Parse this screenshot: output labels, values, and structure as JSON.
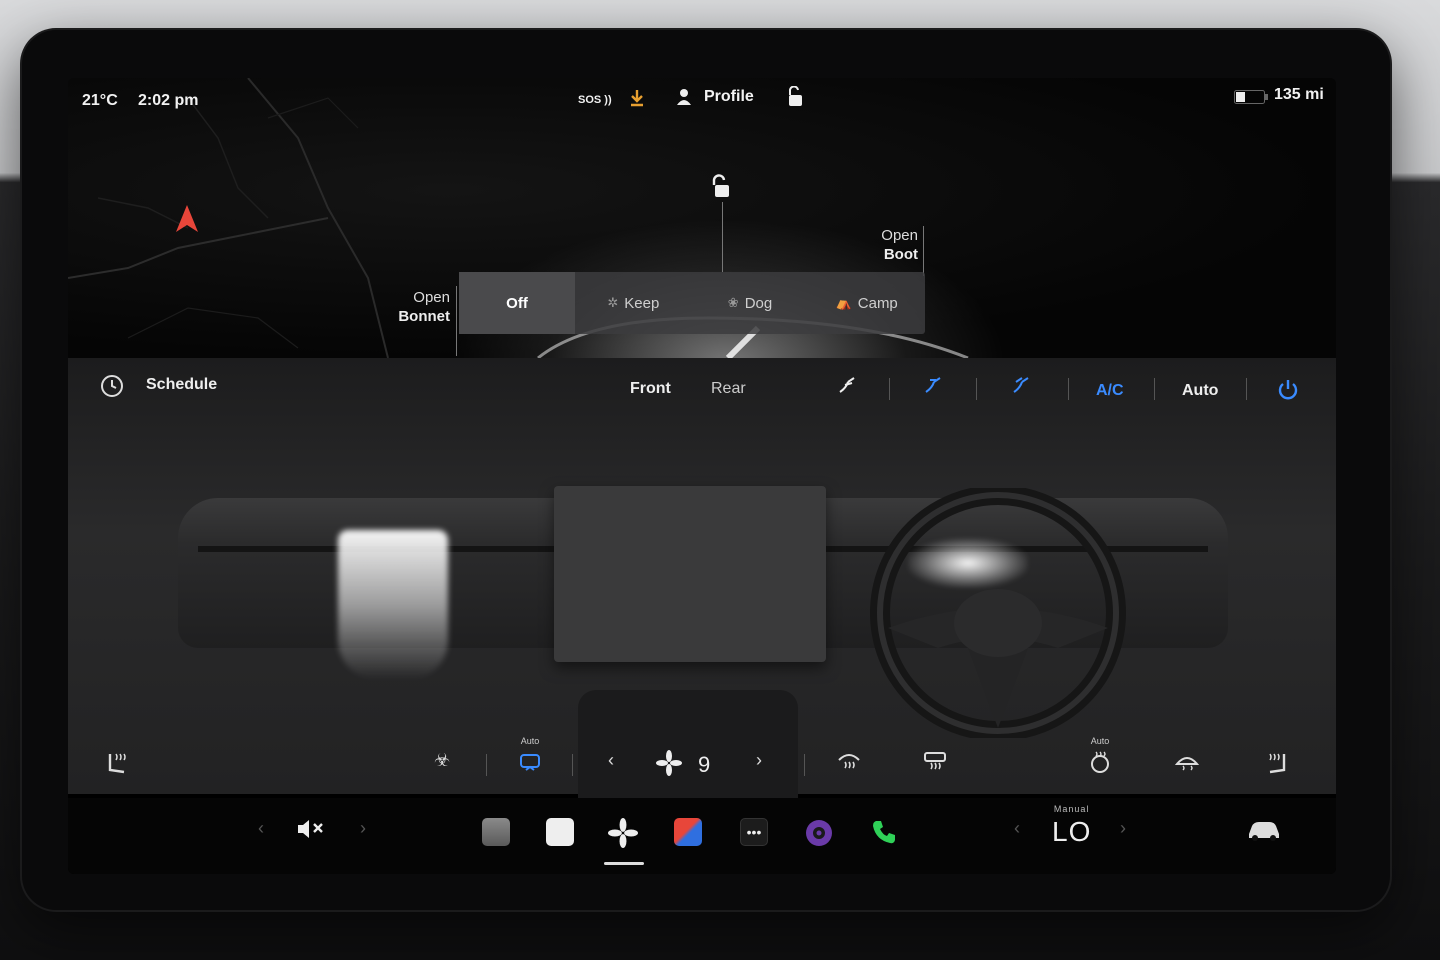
{
  "status": {
    "temperature": "21°C",
    "time": "2:02 pm",
    "sos": "SOS",
    "profile_label": "Profile",
    "range": "135 mi",
    "battery_level": 0.3
  },
  "vehicle": {
    "open_bonnet": [
      "Open",
      "Bonnet"
    ],
    "open_boot": [
      "Open",
      "Boot"
    ]
  },
  "climate_keep_modes": {
    "active": "Off",
    "items": [
      "Off",
      "Keep",
      "Dog",
      "Camp"
    ]
  },
  "climate": {
    "schedule_label": "Schedule",
    "front_label": "Front",
    "rear_label": "Rear",
    "ac_label": "A/C",
    "auto_label": "Auto",
    "fan_speed": "9",
    "recirc_mode": "Auto",
    "steering_heat_mode": "Auto"
  },
  "dock": {
    "temp_mode": "Manual",
    "temp_value": "LO"
  },
  "colors": {
    "accent_blue": "#3a8bff",
    "nav_red": "#e8463a",
    "download_orange": "#e8a030",
    "phone_green": "#2fd158"
  }
}
